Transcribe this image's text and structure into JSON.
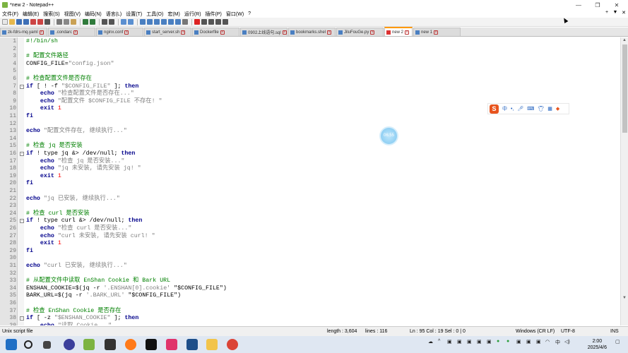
{
  "window": {
    "title": "*new 2 - Notepad++",
    "controls": {
      "minimize": "—",
      "maximize": "❐",
      "close": "✕"
    }
  },
  "menu": {
    "items": [
      "文件(F)",
      "编辑(E)",
      "搜索(S)",
      "视图(V)",
      "编码(N)",
      "语言(L)",
      "设置(T)",
      "工具(O)",
      "宏(M)",
      "运行(R)",
      "插件(P)",
      "窗口(W)",
      "?"
    ],
    "right": [
      "+",
      "▼",
      "✕"
    ]
  },
  "tabs": [
    {
      "label": "zk-fdrs-mq.yaml",
      "active": false
    },
    {
      "label": ".condarc",
      "active": false
    },
    {
      "label": "nginx.conf",
      "active": false
    },
    {
      "label": "start_server.sh",
      "active": false
    },
    {
      "label": "Dockerfile",
      "active": false
    },
    {
      "label": "0902上线语句.sql",
      "active": false
    },
    {
      "label": "bookmarks.shel",
      "active": false
    },
    {
      "label": "JiluFouGe.py",
      "active": false
    },
    {
      "label": "new 2",
      "active": true
    },
    {
      "label": "new 1",
      "active": false
    }
  ],
  "editor": {
    "lines": [
      {
        "n": "1",
        "fold": "",
        "segs": [
          {
            "t": "#!/bin/sh",
            "c": "c"
          }
        ]
      },
      {
        "n": "2",
        "fold": "",
        "segs": []
      },
      {
        "n": "3",
        "fold": "",
        "segs": [
          {
            "t": "# 配置文件路径",
            "c": "c"
          }
        ]
      },
      {
        "n": "4",
        "fold": "",
        "segs": [
          {
            "t": "CONFIG_FILE=",
            "c": "v"
          },
          {
            "t": "\"config.json\"",
            "c": "s"
          }
        ]
      },
      {
        "n": "5",
        "fold": "",
        "segs": []
      },
      {
        "n": "6",
        "fold": "",
        "segs": [
          {
            "t": "# 检查配置文件是否存在",
            "c": "c"
          }
        ]
      },
      {
        "n": "7",
        "fold": "⊟",
        "segs": [
          {
            "t": "if",
            "c": "k"
          },
          {
            "t": " [ ! -f ",
            "c": "v"
          },
          {
            "t": "\"$CONFIG_FILE\"",
            "c": "s"
          },
          {
            "t": " ]; ",
            "c": "v"
          },
          {
            "t": "then",
            "c": "k"
          }
        ]
      },
      {
        "n": "8",
        "fold": "",
        "segs": [
          {
            "t": "    ",
            "c": "v"
          },
          {
            "t": "echo",
            "c": "k"
          },
          {
            "t": " \"检查配置文件是否存在...\"",
            "c": "s"
          }
        ]
      },
      {
        "n": "9",
        "fold": "",
        "segs": [
          {
            "t": "    ",
            "c": "v"
          },
          {
            "t": "echo",
            "c": "k"
          },
          {
            "t": " \"配置文件 $CONFIG_FILE 不存在! \"",
            "c": "s"
          }
        ]
      },
      {
        "n": "10",
        "fold": "",
        "segs": [
          {
            "t": "    ",
            "c": "v"
          },
          {
            "t": "exit",
            "c": "k"
          },
          {
            "t": " 1",
            "c": "n"
          }
        ]
      },
      {
        "n": "11",
        "fold": "",
        "segs": [
          {
            "t": "fi",
            "c": "k"
          }
        ]
      },
      {
        "n": "12",
        "fold": "",
        "segs": []
      },
      {
        "n": "13",
        "fold": "",
        "segs": [
          {
            "t": "echo",
            "c": "k"
          },
          {
            "t": " \"配置文件存在, 继续执行...\"",
            "c": "s"
          }
        ]
      },
      {
        "n": "14",
        "fold": "",
        "segs": []
      },
      {
        "n": "15",
        "fold": "",
        "segs": [
          {
            "t": "# 检查 jq 是否安装",
            "c": "c"
          }
        ]
      },
      {
        "n": "16",
        "fold": "⊟",
        "segs": [
          {
            "t": "if",
            "c": "k"
          },
          {
            "t": " ! type jq &> /dev/null; ",
            "c": "v"
          },
          {
            "t": "then",
            "c": "k"
          }
        ]
      },
      {
        "n": "17",
        "fold": "",
        "segs": [
          {
            "t": "    ",
            "c": "v"
          },
          {
            "t": "echo",
            "c": "k"
          },
          {
            "t": " \"检查 jq 是否安装...\"",
            "c": "s"
          }
        ]
      },
      {
        "n": "18",
        "fold": "",
        "segs": [
          {
            "t": "    ",
            "c": "v"
          },
          {
            "t": "echo",
            "c": "k"
          },
          {
            "t": " \"jq 未安装, 请先安装 jq! \"",
            "c": "s"
          }
        ]
      },
      {
        "n": "19",
        "fold": "",
        "segs": [
          {
            "t": "    ",
            "c": "v"
          },
          {
            "t": "exit",
            "c": "k"
          },
          {
            "t": " 1",
            "c": "n"
          }
        ]
      },
      {
        "n": "20",
        "fold": "",
        "segs": [
          {
            "t": "fi",
            "c": "k"
          }
        ]
      },
      {
        "n": "21",
        "fold": "",
        "segs": []
      },
      {
        "n": "22",
        "fold": "",
        "segs": [
          {
            "t": "echo",
            "c": "k"
          },
          {
            "t": " \"jq 已安装, 继续执行...\"",
            "c": "s"
          }
        ]
      },
      {
        "n": "23",
        "fold": "",
        "segs": []
      },
      {
        "n": "24",
        "fold": "",
        "segs": [
          {
            "t": "# 检查 curl 是否安装",
            "c": "c"
          }
        ]
      },
      {
        "n": "25",
        "fold": "⊟",
        "segs": [
          {
            "t": "if",
            "c": "k"
          },
          {
            "t": " ! type curl &> /dev/null; ",
            "c": "v"
          },
          {
            "t": "then",
            "c": "k"
          }
        ]
      },
      {
        "n": "26",
        "fold": "",
        "segs": [
          {
            "t": "    ",
            "c": "v"
          },
          {
            "t": "echo",
            "c": "k"
          },
          {
            "t": " \"检查 curl 是否安装...\"",
            "c": "s"
          }
        ]
      },
      {
        "n": "27",
        "fold": "",
        "segs": [
          {
            "t": "    ",
            "c": "v"
          },
          {
            "t": "echo",
            "c": "k"
          },
          {
            "t": " \"curl 未安装, 请先安装 curl! \"",
            "c": "s"
          }
        ]
      },
      {
        "n": "28",
        "fold": "",
        "segs": [
          {
            "t": "    ",
            "c": "v"
          },
          {
            "t": "exit",
            "c": "k"
          },
          {
            "t": " 1",
            "c": "n"
          }
        ]
      },
      {
        "n": "29",
        "fold": "",
        "segs": [
          {
            "t": "fi",
            "c": "k"
          }
        ]
      },
      {
        "n": "30",
        "fold": "",
        "segs": []
      },
      {
        "n": "31",
        "fold": "",
        "segs": [
          {
            "t": "echo",
            "c": "k"
          },
          {
            "t": " \"curl 已安装, 继续执行...\"",
            "c": "s"
          }
        ]
      },
      {
        "n": "32",
        "fold": "",
        "segs": []
      },
      {
        "n": "33",
        "fold": "",
        "segs": [
          {
            "t": "# 从配置文件中读取 EnShan Cookie 和 Bark URL",
            "c": "c"
          }
        ]
      },
      {
        "n": "34",
        "fold": "",
        "segs": [
          {
            "t": "ENSHAN_COOKIE=$(jq -r ",
            "c": "v"
          },
          {
            "t": "'.ENSHAN[0].cookie'",
            "c": "s"
          },
          {
            "t": " \"$CONFIG_FILE\")",
            "c": "v"
          }
        ]
      },
      {
        "n": "35",
        "fold": "",
        "segs": [
          {
            "t": "BARK_URL=$(jq -r ",
            "c": "v"
          },
          {
            "t": "'.BARK_URL'",
            "c": "s"
          },
          {
            "t": " \"$CONFIG_FILE\")",
            "c": "v"
          }
        ]
      },
      {
        "n": "36",
        "fold": "",
        "segs": []
      },
      {
        "n": "37",
        "fold": "",
        "segs": [
          {
            "t": "# 检查 EnShan Cookie 是否存在",
            "c": "c"
          }
        ]
      },
      {
        "n": "38",
        "fold": "⊟",
        "segs": [
          {
            "t": "if",
            "c": "k"
          },
          {
            "t": " [ -z ",
            "c": "v"
          },
          {
            "t": "\"$ENSHAN_COOKIE\"",
            "c": "s"
          },
          {
            "t": " ]; ",
            "c": "v"
          },
          {
            "t": "then",
            "c": "k"
          }
        ]
      },
      {
        "n": "39",
        "fold": "",
        "segs": [
          {
            "t": "    ",
            "c": "v"
          },
          {
            "t": "echo",
            "c": "k"
          },
          {
            "t": " \"读取 Cookie...\"",
            "c": "s"
          }
        ]
      }
    ]
  },
  "status": {
    "filetype": "Unix script file",
    "length": "length : 3,604",
    "lines": "lines : 116",
    "position": "Ln : 95    Col : 19    Sel : 0 | 0",
    "eol": "Windows (CR LF)",
    "encoding": "UTF-8",
    "mode": "INS"
  },
  "overlay": {
    "net_speed": "06:55",
    "ime_logo": "S",
    "ime_mode": "中"
  },
  "taskbar": {
    "time": "2:00",
    "date": "2025/4/6",
    "ime_indicator": "中"
  },
  "colors": {
    "comment": "#008000",
    "keyword": "#00008b",
    "string": "#808080",
    "number": "#ff0000",
    "active_tab_accent": "#ff9900"
  }
}
